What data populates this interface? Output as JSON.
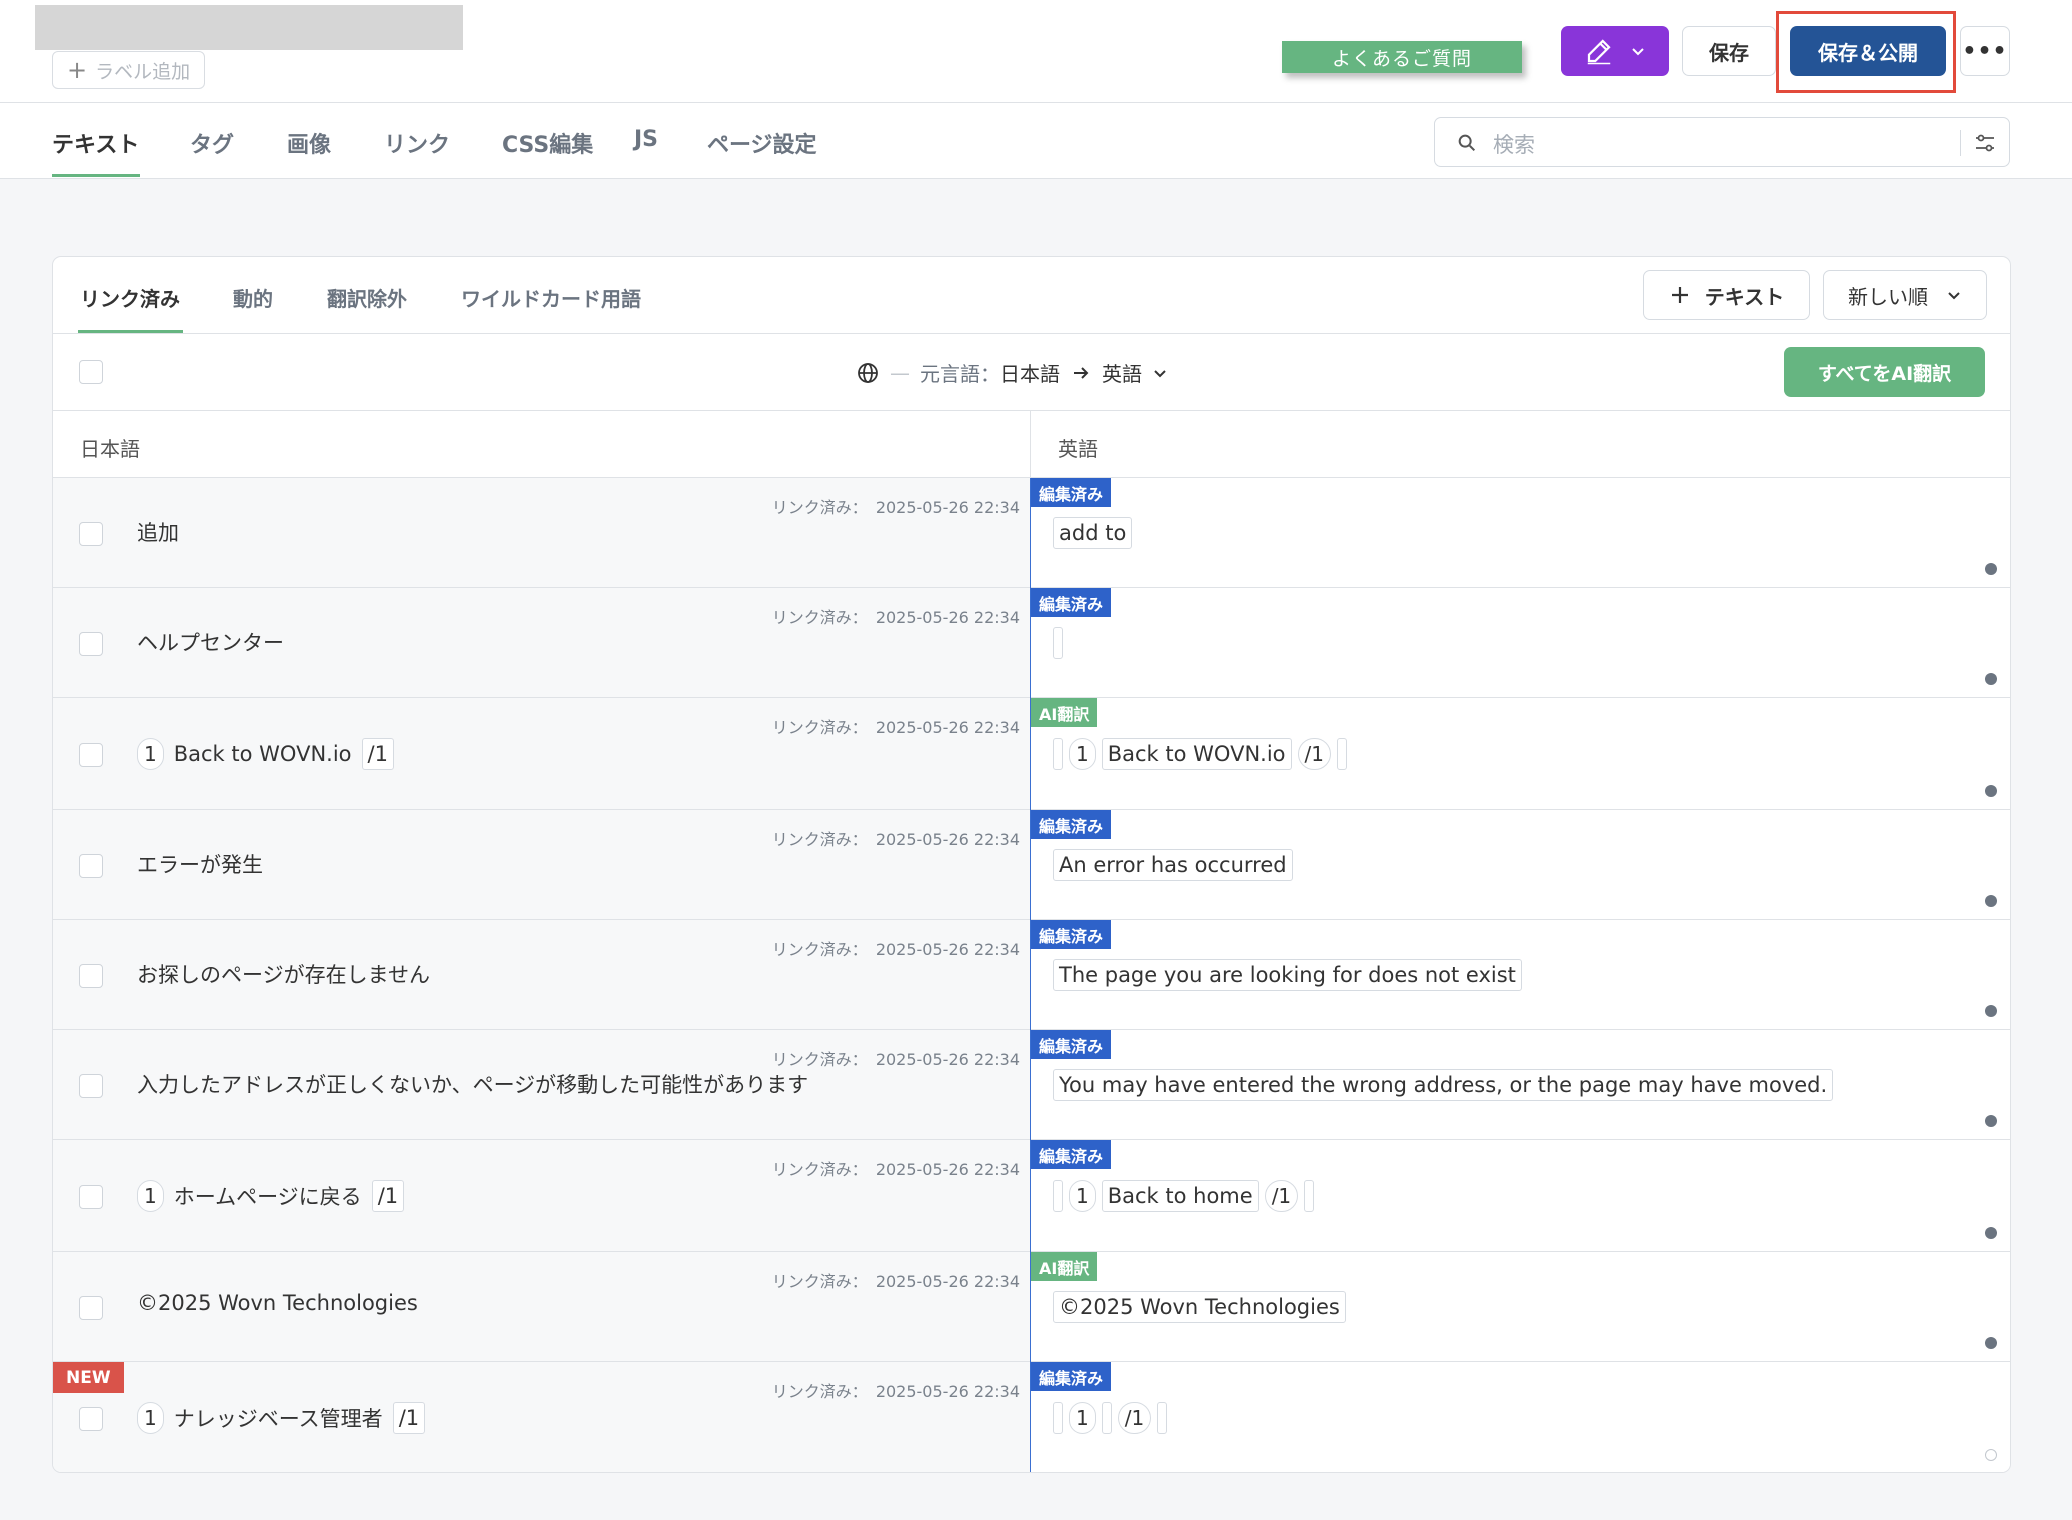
{
  "header": {
    "add_label": "ラベル追加",
    "faq_label": "よくあるご質問",
    "save_label": "保存",
    "publish_label": "保存＆公開",
    "more_label": "•••"
  },
  "tabs": [
    "テキスト",
    "タグ",
    "画像",
    "リンク",
    "CSS編集",
    "JS",
    "ページ設定"
  ],
  "search": {
    "placeholder": "検索"
  },
  "subtabs": [
    "リンク済み",
    "動的",
    "翻訳除外",
    "ワイルドカード用語"
  ],
  "toolbar": {
    "add_text": "テキスト",
    "sort": "新しい順"
  },
  "langbar": {
    "dash": "—",
    "source_label": "元言語：",
    "source_lang": "日本語",
    "target_lang": "英語",
    "ai_all": "すべてをAI翻訳"
  },
  "columns": {
    "source": "日本語",
    "target": "英語"
  },
  "meta_label": "リンク済み：",
  "meta_date": "2025-05-26 22:34",
  "status": {
    "edited": "編集済み",
    "ai": "AI翻訳"
  },
  "new_badge": "NEW",
  "rows": [
    {
      "src_text": "追加",
      "tr_text": "add to"
    },
    {
      "src_text": "ヘルプセンター"
    },
    {
      "src_num": "1",
      "src_text": "Back to WOVN.io",
      "src_close": "/1",
      "tr_num": "1",
      "tr_text": "Back to WOVN.io",
      "tr_close": "/1"
    },
    {
      "src_text": "エラーが発生",
      "tr_text": "An error has occurred"
    },
    {
      "src_text": "お探しのページが存在しません",
      "tr_text": "The page you are looking for does not exist"
    },
    {
      "src_text": "入力したアドレスが正しくないか、ページが移動した可能性があります",
      "tr_text": "You may have entered the wrong address, or the page may have moved."
    },
    {
      "src_num": "1",
      "src_text": "ホームページに戻る",
      "src_close": "/1",
      "tr_num": "1",
      "tr_text": "Back to home",
      "tr_close": "/1"
    },
    {
      "src_text": "©2025 Wovn Technologies",
      "tr_text": "©2025 Wovn Technologies"
    },
    {
      "src_num": "1",
      "src_text": "ナレッジベース管理者",
      "src_close": "/1",
      "tr_num": "1",
      "tr_close": "/1"
    }
  ],
  "colors": {
    "green": "#66b581",
    "blue": "#245496",
    "purple": "#8935d9",
    "edited": "#2e62c9",
    "red": "#e24a3b"
  }
}
